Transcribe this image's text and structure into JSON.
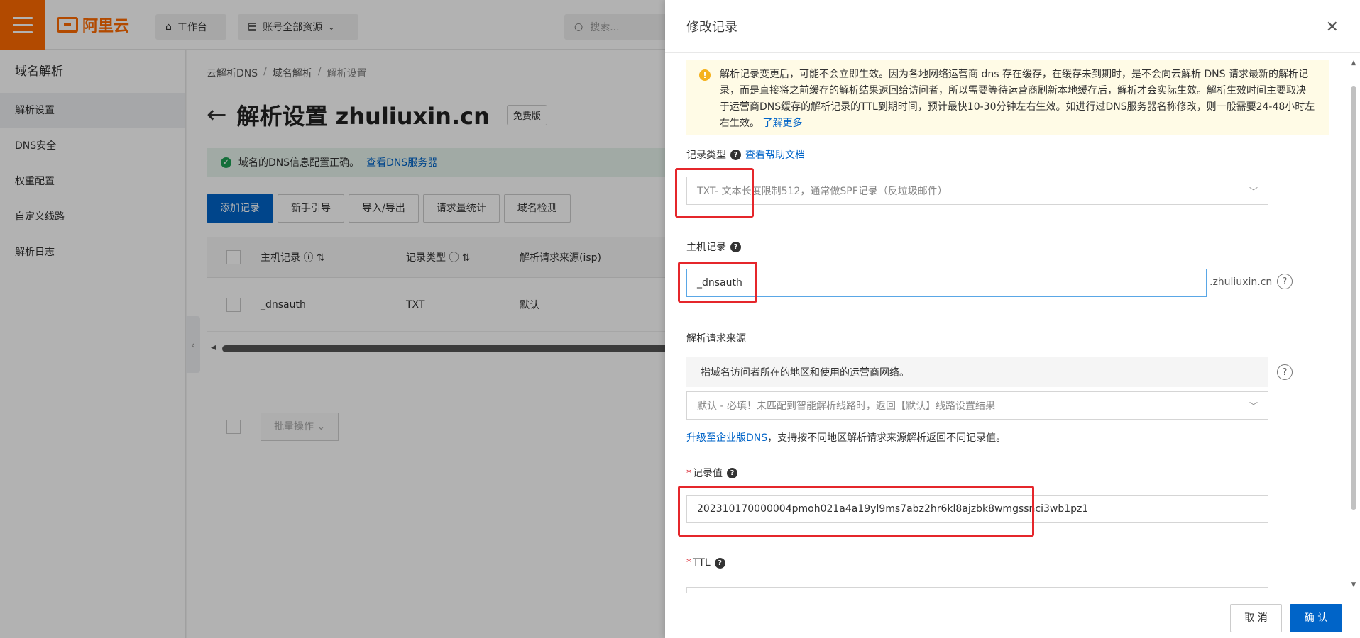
{
  "topbar": {
    "logo_text": "阿里云",
    "workbench_label": "工作台",
    "resource_label": "账号全部资源",
    "search_placeholder": "搜索..."
  },
  "sidebar": {
    "title": "域名解析",
    "items": [
      {
        "label": "解析设置",
        "active": true
      },
      {
        "label": "DNS安全",
        "active": false
      },
      {
        "label": "权重配置",
        "active": false
      },
      {
        "label": "自定义线路",
        "active": false
      },
      {
        "label": "解析日志",
        "active": false
      }
    ]
  },
  "main": {
    "breadcrumb": [
      "云解析DNS",
      "域名解析",
      "解析设置"
    ],
    "title": "解析设置 zhuliuxin.cn",
    "edition_badge": "免费版",
    "dns_notice": "域名的DNS信息配置正确。",
    "dns_notice_link": "查看DNS服务器",
    "buttons": [
      "添加记录",
      "新手引导",
      "导入/导出",
      "请求量统计",
      "域名检测"
    ],
    "table": {
      "columns": [
        "主机记录",
        "记录类型",
        "解析请求来源(isp)"
      ],
      "rows": [
        {
          "host": "_dnsauth",
          "type": "TXT",
          "line": "默认"
        }
      ]
    },
    "batch_label": "批量操作"
  },
  "drawer": {
    "title": "修改记录",
    "warning_text": "解析记录变更后，可能不会立即生效。因为各地网络运营商 dns 存在缓存，在缓存未到期时，是不会向云解析 DNS 请求最新的解析记录，而是直接将之前缓存的解析结果返回给访问者，所以需要等待运营商刷新本地缓存后，解析才会实际生效。解析生效时间主要取决于运营商DNS缓存的解析记录的TTL到期时间，预计最快10-30分钟左右生效。如进行过DNS服务器名称修改，则一般需要24-48小时左右生效。",
    "warning_link": "了解更多",
    "record_type_label": "记录类型",
    "record_type_help_link": "查看帮助文档",
    "record_type_value": "TXT- 文本长度限制512，通常做SPF记录（反垃圾邮件）",
    "host_label": "主机记录",
    "host_value": "_dnsauth",
    "host_suffix": ".zhuliuxin.cn",
    "source_label": "解析请求来源",
    "source_hint": "指域名访问者所在的地区和使用的运营商网络。",
    "source_value": "默认 - 必填！未匹配到智能解析线路时，返回【默认】线路设置结果",
    "upgrade_link": "升级至企业版DNS",
    "upgrade_text": "，支持按不同地区解析请求来源解析返回不同记录值。",
    "value_label": "记录值",
    "value_value": "202310170000004pmoh021a4a19yl9ms7abz2hr6kl8ajzbk8wmgssnci3wb1pz1",
    "ttl_label": "TTL",
    "cancel_label": "取 消",
    "confirm_label": "确 认"
  }
}
